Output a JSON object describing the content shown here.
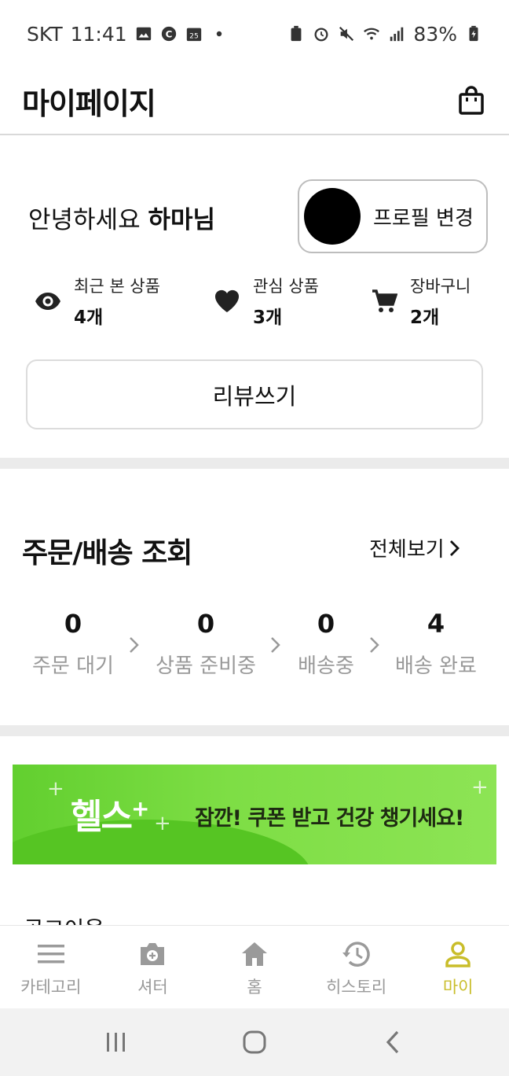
{
  "status_bar": {
    "carrier": "SKT",
    "time": "11:41",
    "battery": "83%"
  },
  "header": {
    "title": "마이페이지",
    "cart_icon": "shopping-bag-icon"
  },
  "profile": {
    "greeting_prefix": "안녕하세요",
    "user_name": "하마님",
    "edit_profile_label": "프로필 변경"
  },
  "stats": [
    {
      "icon": "eye-icon",
      "label": "최근 본 상품",
      "value": "4개"
    },
    {
      "icon": "heart-icon",
      "label": "관심 상품",
      "value": "3개"
    },
    {
      "icon": "cart-icon",
      "label": "장바구니",
      "value": "2개"
    }
  ],
  "review_button_label": "리뷰쓰기",
  "orders": {
    "title": "주문/배송 조회",
    "view_all_label": "전체보기",
    "steps": [
      {
        "count": "0",
        "label": "주문 대기"
      },
      {
        "count": "0",
        "label": "상품 준비중"
      },
      {
        "count": "0",
        "label": "배송중"
      },
      {
        "count": "4",
        "label": "배송 완료"
      }
    ]
  },
  "banner": {
    "logo_text": "헬스",
    "logo_plus": "+",
    "message": "잠깐! 쿠폰 받고 건강 챙기세요!"
  },
  "peek_text": "공고이용",
  "bottom_nav": [
    {
      "icon": "menu-icon",
      "label": "카테고리",
      "active": false
    },
    {
      "icon": "camera-icon",
      "label": "셔터",
      "active": false
    },
    {
      "icon": "home-icon",
      "label": "홈",
      "active": false
    },
    {
      "icon": "history-icon",
      "label": "히스토리",
      "active": false
    },
    {
      "icon": "person-icon",
      "label": "마이",
      "active": true
    }
  ],
  "colors": {
    "accent": "#c9bd2a",
    "banner_green": "#7ede45",
    "muted_text": "#999999"
  }
}
